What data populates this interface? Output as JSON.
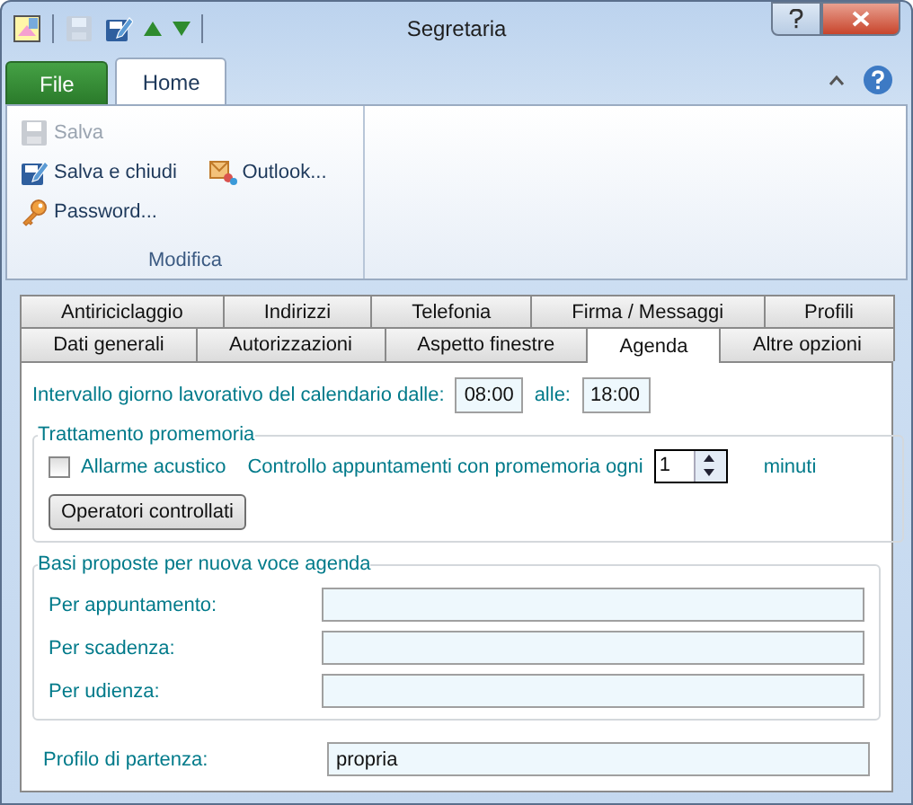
{
  "window": {
    "title": "Segretaria"
  },
  "quick_access": [
    {
      "kind": "save",
      "disabled": true
    },
    {
      "kind": "save-close",
      "disabled": false
    },
    {
      "kind": "up",
      "disabled": false
    },
    {
      "kind": "down",
      "disabled": false
    }
  ],
  "ribbon": {
    "tabs": [
      {
        "label": "File",
        "kind": "file",
        "selected": false
      },
      {
        "label": "Home",
        "kind": "tab",
        "selected": true
      }
    ],
    "group": {
      "label": "Modifica",
      "items": [
        {
          "label": "Salva",
          "kind": "save",
          "disabled": true
        },
        {
          "label": "Salva e chiudi",
          "kind": "save-close",
          "disabled": false
        },
        {
          "label": "Outlook...",
          "kind": "outlook",
          "disabled": false
        },
        {
          "label": "Password...",
          "kind": "key",
          "disabled": false
        }
      ]
    }
  },
  "dialog_tabs": {
    "rows": [
      [
        {
          "label": "Antiriciclaggio",
          "selected": false
        },
        {
          "label": "Indirizzi",
          "selected": false
        },
        {
          "label": "Telefonia",
          "selected": false
        },
        {
          "label": "Firma / Messaggi",
          "selected": false
        },
        {
          "label": "Profili",
          "selected": false
        }
      ],
      [
        {
          "label": "Dati generali",
          "selected": false
        },
        {
          "label": "Autorizzazioni",
          "selected": false
        },
        {
          "label": "Aspetto finestre",
          "selected": false
        },
        {
          "label": "Agenda",
          "selected": true
        },
        {
          "label": "Altre opzioni",
          "selected": false
        }
      ]
    ]
  },
  "work_hours": {
    "label": "Intervallo giorno lavorativo del calendario dalle:",
    "from": "08:00",
    "to_label": "alle:",
    "to": "18:00"
  },
  "reminders": {
    "title": "Trattamento promemoria",
    "alarm": {
      "label": "Allarme acustico",
      "checked": false
    },
    "interval_label": "Controllo appuntamenti con promemoria ogni",
    "interval": "1",
    "unit": "minuti",
    "button": "Operatori controllati"
  },
  "defaults": {
    "title": "Basi proposte per nuova voce agenda",
    "fields": [
      {
        "label": "Per appuntamento:"
      },
      {
        "label": "Per scadenza:"
      },
      {
        "label": "Per udienza:"
      }
    ]
  },
  "start_profile": {
    "label": "Profilo di partenza:",
    "value": "propria"
  }
}
